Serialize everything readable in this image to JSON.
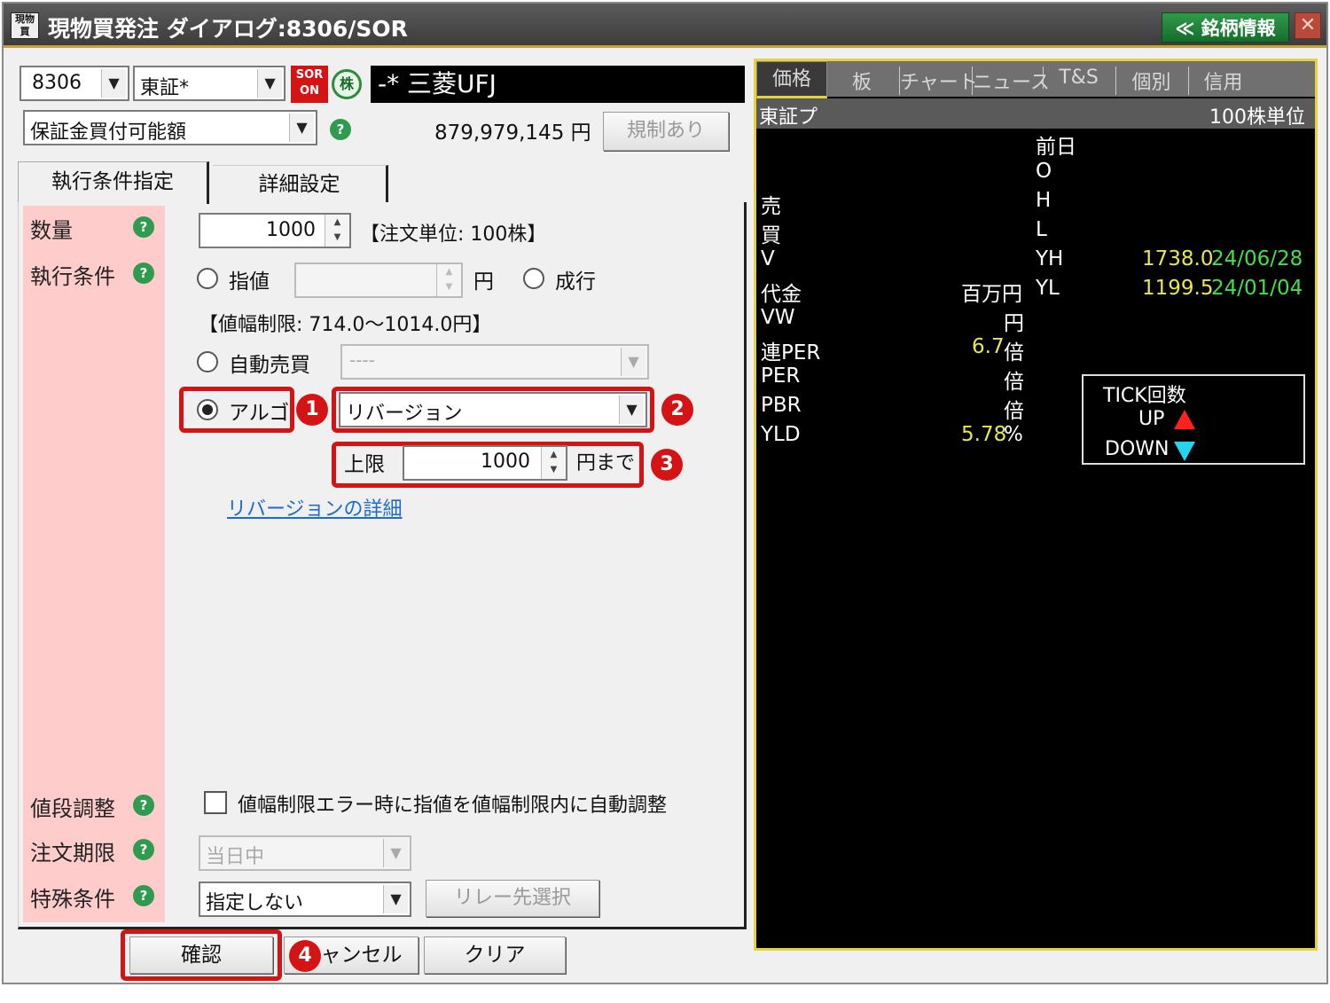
{
  "window": {
    "title": "現物買発注 ダイアログ:8306/SOR",
    "meigara_button": "≪ 銘柄情報",
    "close": "✕",
    "app_icon": "現物 買"
  },
  "symbol": {
    "code": "8306",
    "market": "東証*",
    "sor_badge": "SOR ON",
    "kabu_badge": "株",
    "name": "-* 三菱UFJ"
  },
  "margin": {
    "select": "保証金買付可能額",
    "amount": "879,979,145 円",
    "kisei_button": "規制あり"
  },
  "tabs": {
    "exec": "執行条件指定",
    "detail": "詳細設定"
  },
  "labels": {
    "quantity": "数量",
    "exec": "執行条件",
    "price_adjust": "値段調整",
    "expiry": "注文期限",
    "special": "特殊条件"
  },
  "quantity": {
    "value": "1000",
    "unit_note": "【注文単位: 100株】"
  },
  "exec": {
    "limit_label": "指値",
    "limit_unit": "円",
    "market_label": "成行",
    "price_range": "【値幅制限: 714.0〜1014.0円】",
    "auto_label": "自動売買",
    "auto_select": "----",
    "algo_label": "アルゴ",
    "algo_select": "リバージョン",
    "upper_label": "上限",
    "upper_value": "1000",
    "upper_unit": "円まで",
    "detail_link": "リバージョンの詳細"
  },
  "price_adjust": {
    "checkbox_label": "値幅制限エラー時に指値を値幅制限内に自動調整"
  },
  "expiry": {
    "select": "当日中"
  },
  "special": {
    "select": "指定しない",
    "relay_button": "リレー先選択"
  },
  "buttons": {
    "confirm": "確認",
    "cancel": "キャンセル",
    "clear": "クリア"
  },
  "badges": {
    "b1": "1",
    "b2": "2",
    "b3": "3",
    "b4": "4"
  },
  "right": {
    "tabs": [
      "価格",
      "板",
      "チャート",
      "ニュース",
      "T&S",
      "個別",
      "信用"
    ],
    "market": "東証プ",
    "unit": "100株単位",
    "left_rows": [
      {
        "label": "売",
        "value": "",
        "unit": ""
      },
      {
        "label": "買",
        "value": "",
        "unit": ""
      },
      {
        "label": "V",
        "value": "",
        "unit": ""
      },
      {
        "label": "代金",
        "value": "",
        "unit": "百万円"
      },
      {
        "label": "VW",
        "value": "",
        "unit": "円"
      },
      {
        "label": "連PER",
        "value": "6.7",
        "unit": "倍"
      },
      {
        "label": "PER",
        "value": "",
        "unit": "倍"
      },
      {
        "label": "PBR",
        "value": "",
        "unit": "倍"
      },
      {
        "label": "YLD",
        "value": "5.78",
        "unit": "%"
      }
    ],
    "ohl": {
      "prev": "前日",
      "o": "O",
      "h": "H",
      "l": "L"
    },
    "yh": {
      "label": "YH",
      "price": "1738.0",
      "date": "24/06/28"
    },
    "yl": {
      "label": "YL",
      "price": "1199.5",
      "date": "24/01/04"
    },
    "tick": {
      "title": "TICK回数",
      "up": "UP",
      "down": "DOWN"
    }
  },
  "colors": {
    "pink": "#ffcccc",
    "yellow_value": "#e8e84a",
    "green_date": "#3fe04a",
    "border_yellow": "#e6d23a",
    "red": "#d41414",
    "up_red": "#ff2020",
    "down_cyan": "#22d4ee"
  }
}
